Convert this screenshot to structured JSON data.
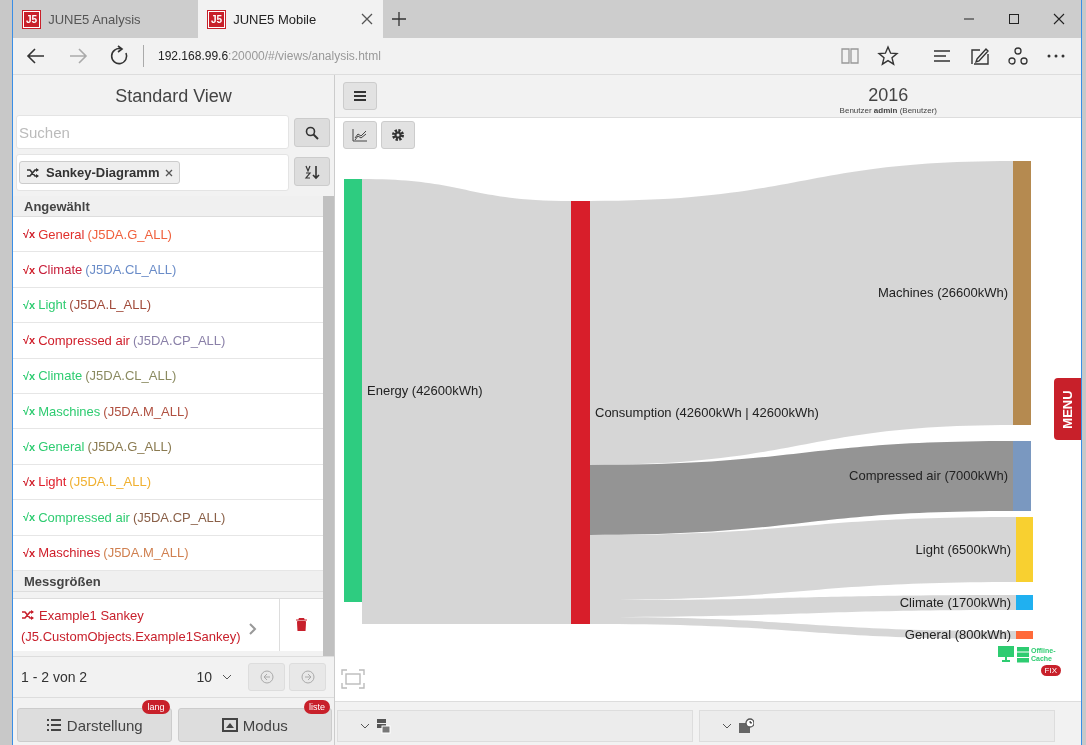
{
  "browser": {
    "tabs": [
      {
        "icon_text": "J5",
        "title": "JUNE5 Analysis",
        "selected": false
      },
      {
        "icon_text": "J5",
        "title": "JUNE5 Mobile",
        "selected": true
      }
    ],
    "address": {
      "host": "192.168.99.6",
      "rest": ":20000/#/views/analysis.html"
    }
  },
  "sidebar": {
    "title": "Standard View",
    "search": {
      "placeholder": "Suchen"
    },
    "filter_tag": "Sankey-Diagramm",
    "sections": [
      {
        "title": "Angewählt",
        "items": [
          {
            "symbol": "√x",
            "color": "#d0202c",
            "name": {
              "text": "General",
              "color": "#e0302c"
            },
            "code": {
              "text": "(J5DA.G_ALL)",
              "color": "#f0603c"
            }
          },
          {
            "symbol": "√x",
            "color": "#d0202c",
            "name": {
              "text": "Climate",
              "color": "#c8203c"
            },
            "code": {
              "text": "(J5DA.CL_ALL)",
              "color": "#6a8cc8"
            }
          },
          {
            "symbol": "√x",
            "color": "#2ecc71",
            "name": {
              "text": "Light",
              "color": "#2ecc71"
            },
            "code": {
              "text": "(J5DA.L_ALL)",
              "color": "#a04a3a"
            }
          },
          {
            "symbol": "√x",
            "color": "#d0202c",
            "name": {
              "text": "Compressed air",
              "color": "#d0202c"
            },
            "code": {
              "text": "(J5DA.CP_ALL)",
              "color": "#8a80a8"
            }
          },
          {
            "symbol": "√x",
            "color": "#2ecc71",
            "name": {
              "text": "Climate",
              "color": "#2ecc71"
            },
            "code": {
              "text": "(J5DA.CL_ALL)",
              "color": "#8a8a60"
            }
          },
          {
            "symbol": "√x",
            "color": "#2ecc71",
            "name": {
              "text": "Maschines",
              "color": "#2ecc71"
            },
            "code": {
              "text": "(J5DA.M_ALL)",
              "color": "#b05040"
            }
          },
          {
            "symbol": "√x",
            "color": "#2ecc71",
            "name": {
              "text": "General",
              "color": "#2ecc71"
            },
            "code": {
              "text": "(J5DA.G_ALL)",
              "color": "#8a7a50"
            }
          },
          {
            "symbol": "√x",
            "color": "#d0202c",
            "name": {
              "text": "Light",
              "color": "#e0202c"
            },
            "code": {
              "text": "(J5DA.L_ALL)",
              "color": "#f0b030"
            }
          },
          {
            "symbol": "√x",
            "color": "#2ecc71",
            "name": {
              "text": "Compressed air",
              "color": "#2ecc71"
            },
            "code": {
              "text": "(J5DA.CP_ALL)",
              "color": "#8a6048"
            }
          },
          {
            "symbol": "√x",
            "color": "#d0202c",
            "name": {
              "text": "Maschines",
              "color": "#d0202c"
            },
            "code": {
              "text": "(J5DA.M_ALL)",
              "color": "#d08050"
            }
          }
        ]
      },
      {
        "title": "Messgrößen",
        "objects": [
          {
            "name": "Example1 Sankey",
            "code": "(J5.CustomObjects.Example1Sankey)"
          }
        ]
      }
    ],
    "pagination": {
      "summary": "1 - 2 von 2",
      "page_size": "10"
    },
    "buttons": [
      {
        "label": "Darstellung",
        "badge": "lang"
      },
      {
        "label": "Modus",
        "badge": "liste"
      }
    ]
  },
  "main": {
    "year": "2016",
    "user_line": "Benutzer **admin** (Benutzer)",
    "sankey": {
      "nodes": [
        {
          "label": "Energy (42600kWh)",
          "color": "#2ecc80"
        },
        {
          "label": "Consumption (42600kWh | 42600kWh)",
          "color": "#d81e2a"
        },
        {
          "label": "Machines (26600kWh)",
          "color": "#b58a50"
        },
        {
          "label": "Compressed air (7000kWh)",
          "color": "#7a98c0"
        },
        {
          "label": "Light (6500kWh)",
          "color": "#f8d030"
        },
        {
          "label": "Climate (1700kWh)",
          "color": "#20b0f0"
        },
        {
          "label": "General (800kWh)",
          "color": "#ff6a3a"
        }
      ],
      "links": [
        {
          "highlighted": false
        },
        {
          "highlighted": false
        },
        {
          "highlighted": true
        },
        {
          "highlighted": false
        },
        {
          "highlighted": false
        },
        {
          "highlighted": false
        }
      ]
    },
    "menu_tab": "MENU",
    "cache": {
      "label": "Offline-Cache",
      "badge": "FIX"
    }
  }
}
